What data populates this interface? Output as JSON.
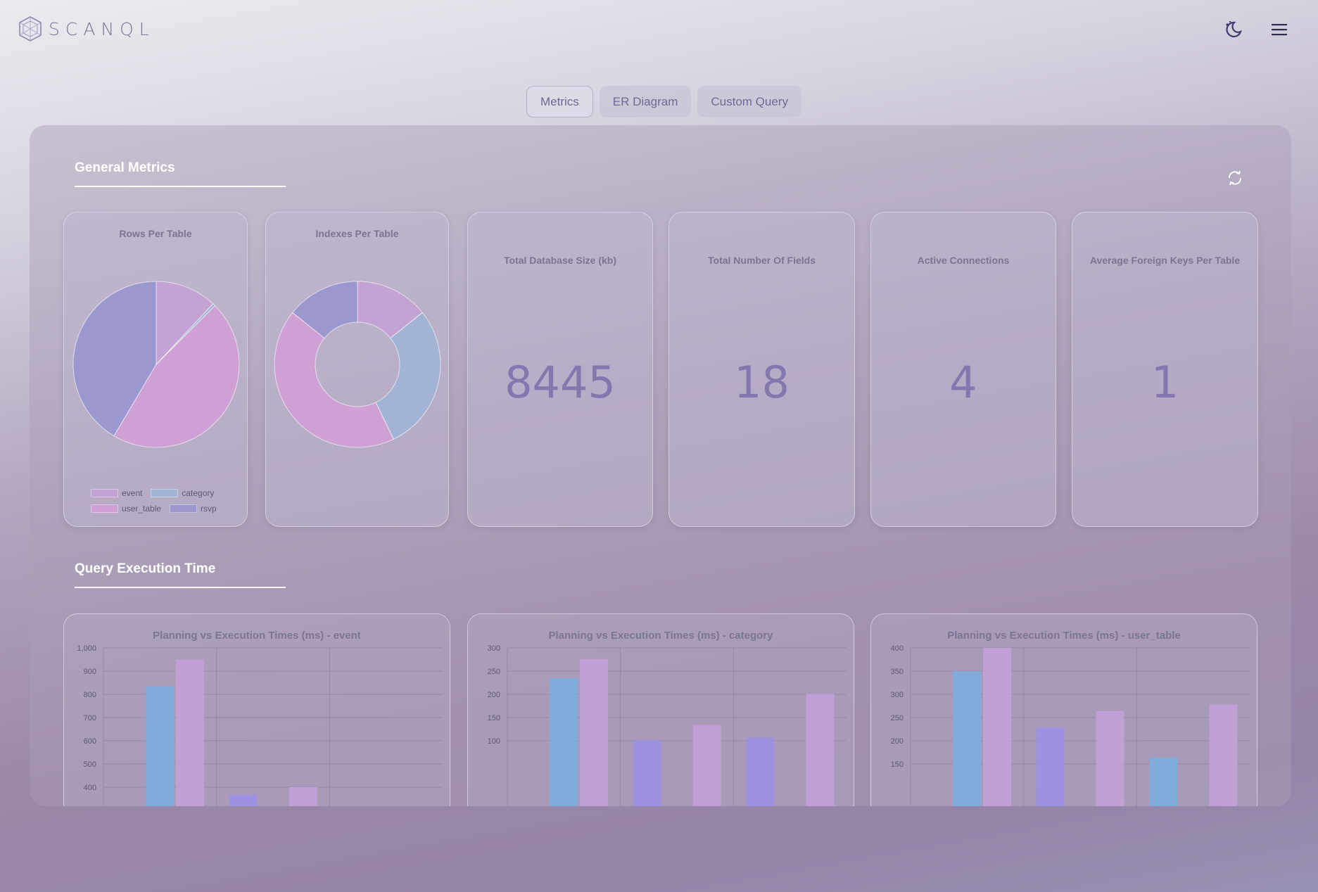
{
  "app": {
    "logo_text": "SCANQL"
  },
  "header": {
    "theme_icon": "moon-icon",
    "menu_icon": "hamburger-icon"
  },
  "tabs": [
    {
      "label": "Metrics",
      "active": true
    },
    {
      "label": "ER Diagram",
      "active": false
    },
    {
      "label": "Custom Query",
      "active": false
    }
  ],
  "sections": {
    "general_metrics": "General Metrics",
    "query_execution_time": "Query Execution Time"
  },
  "cards": {
    "rows_per_table": {
      "title": "Rows Per Table"
    },
    "indexes_per_table": {
      "title": "Indexes Per Table"
    },
    "db_size": {
      "title": "Total Database Size (kb)",
      "value": "8445"
    },
    "fields": {
      "title": "Total Number Of Fields",
      "value": "18"
    },
    "connections": {
      "title": "Active Connections",
      "value": "4"
    },
    "foreign_keys": {
      "title": "Average Foreign Keys Per Table",
      "value": "1"
    }
  },
  "legend": [
    {
      "label": "event",
      "color": "#c3a3d3"
    },
    {
      "label": "category",
      "color": "#a3b3d3"
    },
    {
      "label": "user_table",
      "color": "#cfa0d4"
    },
    {
      "label": "rsvp",
      "color": "#9a98cf"
    }
  ],
  "colors": {
    "blue": "#7aaedf",
    "purple": "#9b90e6",
    "pink": "#c6a0dc"
  },
  "chart_data": [
    {
      "type": "pie",
      "title": "Rows Per Table",
      "categories": [
        "event",
        "category",
        "user_table",
        "rsvp"
      ],
      "values": [
        12,
        0.5,
        46,
        41.5
      ]
    },
    {
      "type": "pie",
      "title": "Indexes Per Table",
      "categories": [
        "event",
        "category",
        "user_table",
        "rsvp"
      ],
      "values": [
        1,
        2,
        3,
        1
      ]
    },
    {
      "type": "bar",
      "title": "Planning vs Execution Times (ms) - event",
      "yticks": [
        "1,000",
        "900",
        "800",
        "700",
        "600",
        "500",
        "400"
      ],
      "ylim": [
        300,
        1000
      ],
      "bars": [
        {
          "group": 0,
          "slot": 0,
          "value": 835,
          "color": "blue"
        },
        {
          "group": 0,
          "slot": 1,
          "value": 950,
          "color": "pink"
        },
        {
          "group": 1,
          "slot": 0,
          "value": 368,
          "color": "purple"
        },
        {
          "group": 1,
          "slot": 1,
          "value": 400,
          "color": "pink"
        }
      ]
    },
    {
      "type": "bar",
      "title": "Planning vs Execution Times (ms) - category",
      "yticks": [
        "300",
        "250",
        "200",
        "150",
        "100"
      ],
      "ylim": [
        95,
        300
      ],
      "bars": [
        {
          "group": 0,
          "slot": 0,
          "value": 235,
          "color": "blue"
        },
        {
          "group": 0,
          "slot": 1,
          "value": 276,
          "color": "pink"
        },
        {
          "group": 1,
          "slot": 0,
          "value": 101,
          "color": "purple"
        },
        {
          "group": 1,
          "slot": 1,
          "value": 134,
          "color": "pink"
        },
        {
          "group": 2,
          "slot": 0,
          "value": 107,
          "color": "purple"
        },
        {
          "group": 2,
          "slot": 1,
          "value": 201,
          "color": "pink"
        }
      ]
    },
    {
      "type": "bar",
      "title": "Planning vs Execution Times (ms) - user_table",
      "yticks": [
        "400",
        "350",
        "300",
        "250",
        "200",
        "150"
      ],
      "ylim": [
        125,
        400
      ],
      "bars": [
        {
          "group": 0,
          "slot": 0,
          "value": 350,
          "color": "blue"
        },
        {
          "group": 0,
          "slot": 1,
          "value": 400,
          "color": "pink"
        },
        {
          "group": 1,
          "slot": 0,
          "value": 229,
          "color": "purple"
        },
        {
          "group": 1,
          "slot": 1,
          "value": 264,
          "color": "pink"
        },
        {
          "group": 2,
          "slot": 0,
          "value": 164,
          "color": "blue"
        },
        {
          "group": 2,
          "slot": 1,
          "value": 278,
          "color": "pink"
        }
      ]
    }
  ]
}
